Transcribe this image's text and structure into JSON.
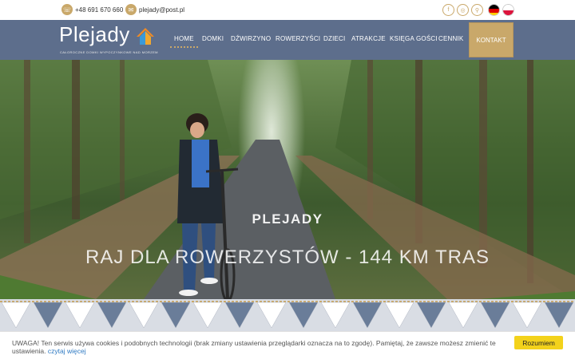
{
  "topbar": {
    "phone": "+48 691 670 660",
    "email": "plejady@post.pl",
    "social": [
      {
        "name": "facebook-icon",
        "glyph": "f"
      },
      {
        "name": "instagram-icon",
        "glyph": "◎"
      },
      {
        "name": "location-pin-icon",
        "glyph": "⚲"
      }
    ],
    "languages": [
      "de-flag-icon",
      "pl-flag-icon"
    ]
  },
  "logo": {
    "name": "Plejady",
    "tagline": "CAŁOROCZNE DOMKI WYPOCZYNKOWE NAD MORZEM"
  },
  "nav": {
    "items": [
      "HOME",
      "DOMKI",
      "DŹWIRZYNO",
      "ROWERZYŚCI",
      "DZIECI",
      "ATRAKCJE",
      "KSIĘGA GOŚCI",
      "CENNIK"
    ],
    "active": "HOME",
    "contact": "KONTAKT"
  },
  "hero": {
    "title": "PLEJADY",
    "subtitle": "RAJ DLA ROWERZYSTÓW - 144 KM TRAS"
  },
  "cookie": {
    "text": "UWAGA! Ten serwis używa cookies i podobnych technologii (brak zmiany ustawienia przeglądarki oznacza na to zgodę). Pamiętaj, że zawsze możesz zmienić te ustawienia.",
    "link": "czytaj więcej",
    "button": "Rozumiem"
  },
  "colors": {
    "accent": "#c9a86a",
    "nav": "#5d6e8c",
    "cookie_button": "#f3d21b",
    "link": "#2f7ac3"
  }
}
